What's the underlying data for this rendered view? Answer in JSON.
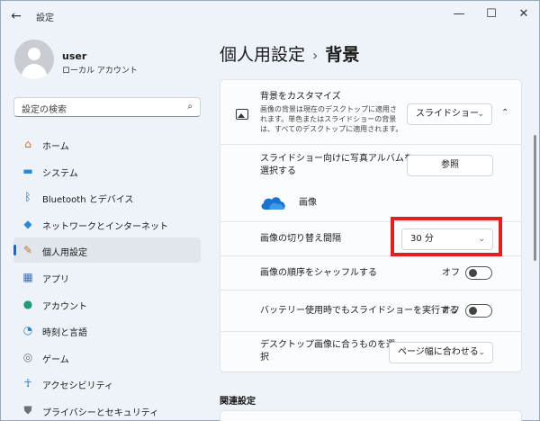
{
  "window": {
    "title": "設定",
    "back_icon": "←",
    "minimize_icon": "—",
    "maximize_icon": "☐",
    "close_icon": "✕"
  },
  "user": {
    "name": "user",
    "account_type": "ローカル アカウント"
  },
  "search": {
    "placeholder": "設定の検索",
    "icon": "⌕"
  },
  "sidebar": {
    "items": [
      {
        "label": "ホーム",
        "icon": "⌂",
        "color": "#d86a2c"
      },
      {
        "label": "システム",
        "icon": "▬",
        "color": "#2b8ad6"
      },
      {
        "label": "Bluetooth とデバイス",
        "icon": "ᛒ",
        "color": "#2167c6"
      },
      {
        "label": "ネットワークとインターネット",
        "icon": "◆",
        "color": "#2b8ad6"
      },
      {
        "label": "個人用設定",
        "icon": "✎",
        "color": "#c7742f"
      },
      {
        "label": "アプリ",
        "icon": "▦",
        "color": "#3a6fb5"
      },
      {
        "label": "アカウント",
        "icon": "●",
        "color": "#1e9b73"
      },
      {
        "label": "時刻と言語",
        "icon": "◔",
        "color": "#2b7ec8"
      },
      {
        "label": "ゲーム",
        "icon": "◎",
        "color": "#6a6f78"
      },
      {
        "label": "アクセシビリティ",
        "icon": "☥",
        "color": "#1b77c5"
      },
      {
        "label": "プライバシーとセキュリティ",
        "icon": "⛊",
        "color": "#6a6f78"
      }
    ],
    "active_index": 4,
    "accent": "#1868c8"
  },
  "breadcrumb": {
    "parent": "個人用設定",
    "separator": "›",
    "current": "背景"
  },
  "settings": {
    "customize": {
      "title": "背景をカスタマイズ",
      "desc_line1": "画像の背景は現在のデスクトップに適用さ",
      "desc_line2": "れます。単色またはスライドショーの背景",
      "desc_line3": "は、すべてのデスクトップに適用されます。",
      "select_value": "スライドショー",
      "chevron": "⌄",
      "collapse_icon": "⌃"
    },
    "album": {
      "label_line1": "スライドショー向けに写真アルバムを",
      "label_line2": "選択する",
      "button": "参照",
      "folder_name": "画像"
    },
    "interval": {
      "label": "画像の切り替え間隔",
      "select_value": "30 分",
      "chevron": "⌄"
    },
    "shuffle": {
      "label": "画像の順序をシャッフルする",
      "state": "オフ"
    },
    "battery": {
      "label": "バッテリー使用時でもスライドショーを実行する",
      "state": "オフ"
    },
    "fit": {
      "label_line1": "デスクトップ画像に合うものを選",
      "label_line2": "択",
      "select_value": "ページ幅に合わせる",
      "chevron": "⌄"
    }
  },
  "related": {
    "title": "関連設定"
  },
  "colors": {
    "highlight": "#e0201c",
    "onedrive": "#1a73d0"
  }
}
